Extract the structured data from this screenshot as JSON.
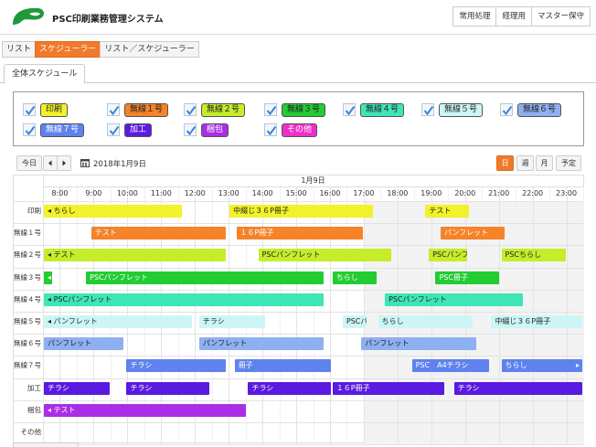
{
  "app": {
    "title": "PSC印刷業務管理システム",
    "logo_icon": "leaf-logo-icon"
  },
  "top_nav": [
    {
      "label": "常用処理"
    },
    {
      "label": "経理用"
    },
    {
      "label": "マスター保守"
    }
  ],
  "view_tabs": [
    {
      "label": "リスト",
      "active": false
    },
    {
      "label": "スケジューラー",
      "active": true
    },
    {
      "label": "リスト／スケジューラー",
      "active": false
    }
  ],
  "sub_tab": {
    "label": "全体スケジュール"
  },
  "filters": [
    {
      "label": "印刷",
      "checked": true,
      "color": "#f2f22a",
      "text_color": "#222"
    },
    {
      "label": "無線１号",
      "checked": true,
      "color": "#f5832a",
      "text_color": "#222"
    },
    {
      "label": "無線２号",
      "checked": true,
      "color": "#c6ec2a",
      "text_color": "#222"
    },
    {
      "label": "無線３号",
      "checked": true,
      "color": "#22cc33",
      "text_color": "#222"
    },
    {
      "label": "無線４号",
      "checked": true,
      "color": "#3ee6b6",
      "text_color": "#222"
    },
    {
      "label": "無線５号",
      "checked": true,
      "color": "#ccf6f6",
      "text_color": "#222"
    },
    {
      "label": "無線６号",
      "checked": true,
      "color": "#8eb0f0",
      "text_color": "#222"
    },
    {
      "label": "無線７号",
      "checked": true,
      "color": "#5e82ee",
      "text_color": "#fff"
    },
    {
      "label": "加工",
      "checked": true,
      "color": "#5a1ae0",
      "text_color": "#fff"
    },
    {
      "label": "梱包",
      "checked": true,
      "color": "#aa2ee6",
      "text_color": "#fff"
    },
    {
      "label": "その他",
      "checked": true,
      "color": "#ee2eca",
      "text_color": "#fff"
    }
  ],
  "toolbar": {
    "today_label": "今日",
    "prev_icon": "arrow-left-icon",
    "next_icon": "arrow-right-icon",
    "calendar_icon": "calendar-icon",
    "current_date": "2018年1月9日",
    "views": [
      {
        "label": "日",
        "active": true
      },
      {
        "label": "週",
        "active": false
      },
      {
        "label": "月",
        "active": false
      },
      {
        "label": "予定",
        "active": false
      }
    ]
  },
  "schedule": {
    "date_header": "1月9日",
    "start_hour": 7.5,
    "end_hour": 23.5,
    "hours": [
      "8:00",
      "9:00",
      "10:00",
      "11:00",
      "12:00",
      "13:00",
      "14:00",
      "15:00",
      "16:00",
      "17:00",
      "18:00",
      "19:00",
      "20:00",
      "21:00",
      "22:00",
      "23:00"
    ],
    "resources": [
      {
        "label": "印刷",
        "color": "#f2f22a",
        "light": true,
        "events": [
          {
            "title": "ちらし",
            "start": 7.5,
            "end": 11.65,
            "cont": true
          },
          {
            "title": "中綴じ３６P冊子",
            "start": 13.0,
            "end": 17.3
          },
          {
            "title": "テスト",
            "start": 18.8,
            "end": 20.15
          }
        ]
      },
      {
        "label": "無線１号",
        "color": "#f5832a",
        "light": false,
        "events": [
          {
            "title": "テスト",
            "start": 8.9,
            "end": 12.95
          },
          {
            "title": "１６P冊子",
            "start": 13.2,
            "end": 17.0
          },
          {
            "title": "パンフレット",
            "start": 19.25,
            "end": 21.2
          }
        ]
      },
      {
        "label": "無線２号",
        "color": "#c6ec2a",
        "light": true,
        "events": [
          {
            "title": "テスト",
            "start": 7.5,
            "end": 12.95,
            "cont": true
          },
          {
            "title": "PSCパンフレット",
            "start": 13.85,
            "end": 17.85
          },
          {
            "title": "PSCパンフレット",
            "start": 18.9,
            "end": 20.1
          },
          {
            "title": "PSCちらし",
            "start": 21.05,
            "end": 23.0
          }
        ]
      },
      {
        "label": "無線３号",
        "color": "#22cc33",
        "light": false,
        "events": [
          {
            "title": "",
            "start": 7.5,
            "end": 7.8,
            "cont": true
          },
          {
            "title": "PSCパンフレット",
            "start": 8.75,
            "end": 15.85
          },
          {
            "title": "ちらし",
            "start": 16.05,
            "end": 17.4
          },
          {
            "title": "PSC冊子",
            "start": 19.1,
            "end": 21.05
          }
        ]
      },
      {
        "label": "無線４号",
        "color": "#3ee6b6",
        "light": true,
        "events": [
          {
            "title": "PSCパンフレット",
            "start": 7.5,
            "end": 15.85,
            "cont": true
          },
          {
            "title": "PSCパンフレット",
            "start": 17.6,
            "end": 21.75
          }
        ]
      },
      {
        "label": "無線５号",
        "color": "#ccf6f6",
        "light": true,
        "events": [
          {
            "title": "パンフレット",
            "start": 7.5,
            "end": 11.95,
            "cont": true
          },
          {
            "title": "チラシ",
            "start": 12.1,
            "end": 14.1
          },
          {
            "title": "PSCパ",
            "start": 16.35,
            "end": 17.1
          },
          {
            "title": "ちらし",
            "start": 17.4,
            "end": 20.25
          },
          {
            "title": "中綴じ３６P冊子",
            "start": 20.75,
            "end": 23.5
          }
        ]
      },
      {
        "label": "無線６号",
        "color": "#8eb0f0",
        "light": true,
        "events": [
          {
            "title": "パンフレット",
            "start": 7.5,
            "end": 9.9
          },
          {
            "title": "パンフレット",
            "start": 12.1,
            "end": 15.85
          },
          {
            "title": "パンフレット",
            "start": 16.9,
            "end": 20.35
          }
        ]
      },
      {
        "label": "無線７号",
        "color": "#5e82ee",
        "light": false,
        "events": [
          {
            "title": "チラシ",
            "start": 9.95,
            "end": 12.95
          },
          {
            "title": "冊子",
            "start": 13.15,
            "end": 16.05
          },
          {
            "title": "PSC　A4チラシ",
            "start": 18.4,
            "end": 20.75
          },
          {
            "title": "ちらし",
            "start": 21.05,
            "end": 23.5,
            "cont_right": true
          }
        ]
      },
      {
        "label": "加工",
        "color": "#5a1ae0",
        "light": false,
        "events": [
          {
            "title": "チラシ",
            "start": 7.5,
            "end": 9.5
          },
          {
            "title": "チラシ",
            "start": 9.95,
            "end": 12.45
          },
          {
            "title": "チラシ",
            "start": 13.55,
            "end": 16.05
          },
          {
            "title": "１６P冊子",
            "start": 16.05,
            "end": 19.4
          },
          {
            "title": "チラシ",
            "start": 19.65,
            "end": 23.5
          }
        ]
      },
      {
        "label": "梱包",
        "color": "#aa2ee6",
        "light": false,
        "events": [
          {
            "title": "テスト",
            "start": 7.5,
            "end": 13.55,
            "cont": true
          }
        ]
      },
      {
        "label": "その他",
        "color": "#ee2eca",
        "light": false,
        "events": []
      }
    ]
  }
}
